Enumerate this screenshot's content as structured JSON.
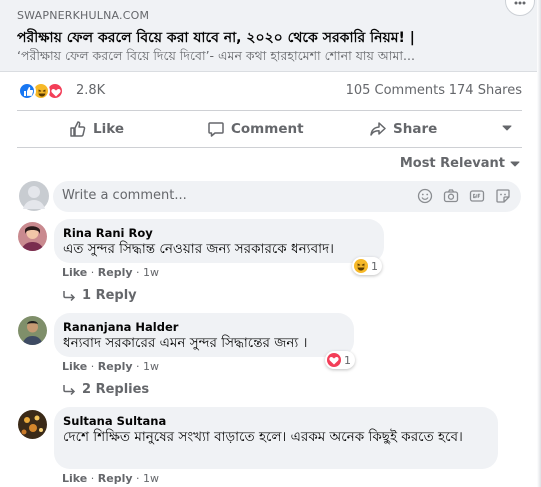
{
  "link_preview": {
    "domain": "SWAPNERKHULNA.COM",
    "title": "পরীক্ষায় ফেল করলে বিয়ে করা যাবে না, ২০২০ থেকে সরকারি নিয়ম! |",
    "description": "‘পরীক্ষায় ফেল করলে বিয়ে দিয়ে দিবো’- এমন কথা হারহামেশা শোনা যায় আমা..."
  },
  "stats": {
    "reactions": [
      "like",
      "haha",
      "love"
    ],
    "reaction_count": "2.8K",
    "comments": "105 Comments",
    "shares": "174 Shares"
  },
  "actions": {
    "like": "Like",
    "comment": "Comment",
    "share": "Share"
  },
  "sort": {
    "label": "Most Relevant"
  },
  "composer": {
    "placeholder": "Write a comment...",
    "icons": [
      "emoji-icon",
      "camera-icon",
      "gif-icon",
      "sticker-icon"
    ]
  },
  "comments": [
    {
      "name": "Rina Rani Roy",
      "text": "এত সুন্দর সিদ্ধান্ত নেওয়ার জন্য সরকারকে ধন্যবাদ।",
      "reaction": "haha",
      "reaction_count": "1",
      "like": "Like",
      "reply": "Reply",
      "time": "1w",
      "replies": "1 Reply"
    },
    {
      "name": "Rananjana Halder",
      "text": "ধন্যবাদ সরকারের এমন সুন্দর সিদ্ধান্তের জন্য ।",
      "reaction": "love",
      "reaction_count": "1",
      "like": "Like",
      "reply": "Reply",
      "time": "1w",
      "replies": "2 Replies"
    },
    {
      "name": "Sultana Sultana",
      "text": "দেশে শিক্ষিত মানুষের সংখ্যা বাড়াতে হলে। এরকম অনেক কিছুই করতে হবে।",
      "like": "Like",
      "reply": "Reply",
      "time": "1w"
    }
  ],
  "colors": {
    "like_blue": "#1877f2",
    "haha_yellow": "#f7b928",
    "love_red": "#f33e58",
    "secondary_text": "#65676b",
    "bubble_bg": "#f0f2f5"
  }
}
